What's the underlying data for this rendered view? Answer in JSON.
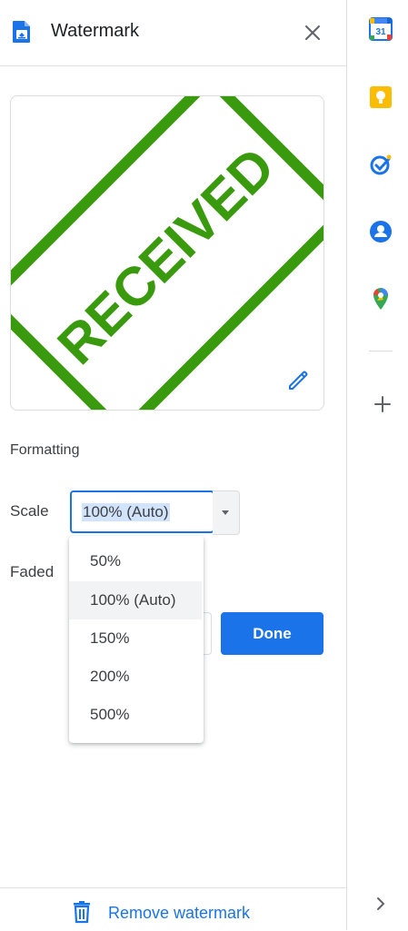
{
  "panel": {
    "title": "Watermark",
    "icons": {
      "doc": "document-watermark-icon",
      "close": "close-icon",
      "edit": "pencil-icon",
      "remove": "trash-icon"
    }
  },
  "preview": {
    "watermark_text": "RECEIVED",
    "stamp_color": "#3a9a0e"
  },
  "formatting": {
    "section_title": "Formatting",
    "scale_label": "Scale",
    "scale_value": "100% (Auto)",
    "faded_label": "Faded"
  },
  "dropdown": {
    "options": [
      "50%",
      "100% (Auto)",
      "150%",
      "200%",
      "500%"
    ],
    "selected": "100% (Auto)"
  },
  "actions": {
    "done_label": "Done",
    "remove_label": "Remove watermark"
  },
  "side_rail": {
    "items": [
      "calendar-icon",
      "keep-icon",
      "tasks-icon",
      "contacts-icon",
      "maps-icon"
    ],
    "calendar_day": "31",
    "add": "plus-icon",
    "expand": "chevron-right-icon"
  },
  "colors": {
    "accent": "#1a73e8",
    "stamp": "#3a9a0e",
    "keep": "#fbbc04"
  }
}
